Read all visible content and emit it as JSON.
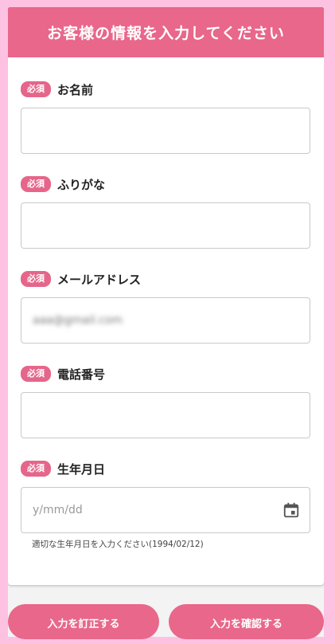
{
  "header": {
    "title": "お客様の情報を入力してください"
  },
  "fields": [
    {
      "badge": "必須",
      "label": "お名前",
      "value": ""
    },
    {
      "badge": "必須",
      "label": "ふりがな",
      "value": ""
    },
    {
      "badge": "必須",
      "label": "メールアドレス",
      "value": "aaa@gmail.com"
    },
    {
      "badge": "必須",
      "label": "電話番号",
      "value": ""
    },
    {
      "badge": "必須",
      "label": "生年月日",
      "placeholder": "y/mm/dd",
      "helper": "適切な生年月日を入力ください(1994/02/12)",
      "icon": "calendar-icon"
    }
  ],
  "buttons": {
    "correct": "入力を訂正する",
    "confirm": "入力を確認する"
  },
  "colors": {
    "accent": "#e8678a",
    "background": "#fdc2e2"
  }
}
